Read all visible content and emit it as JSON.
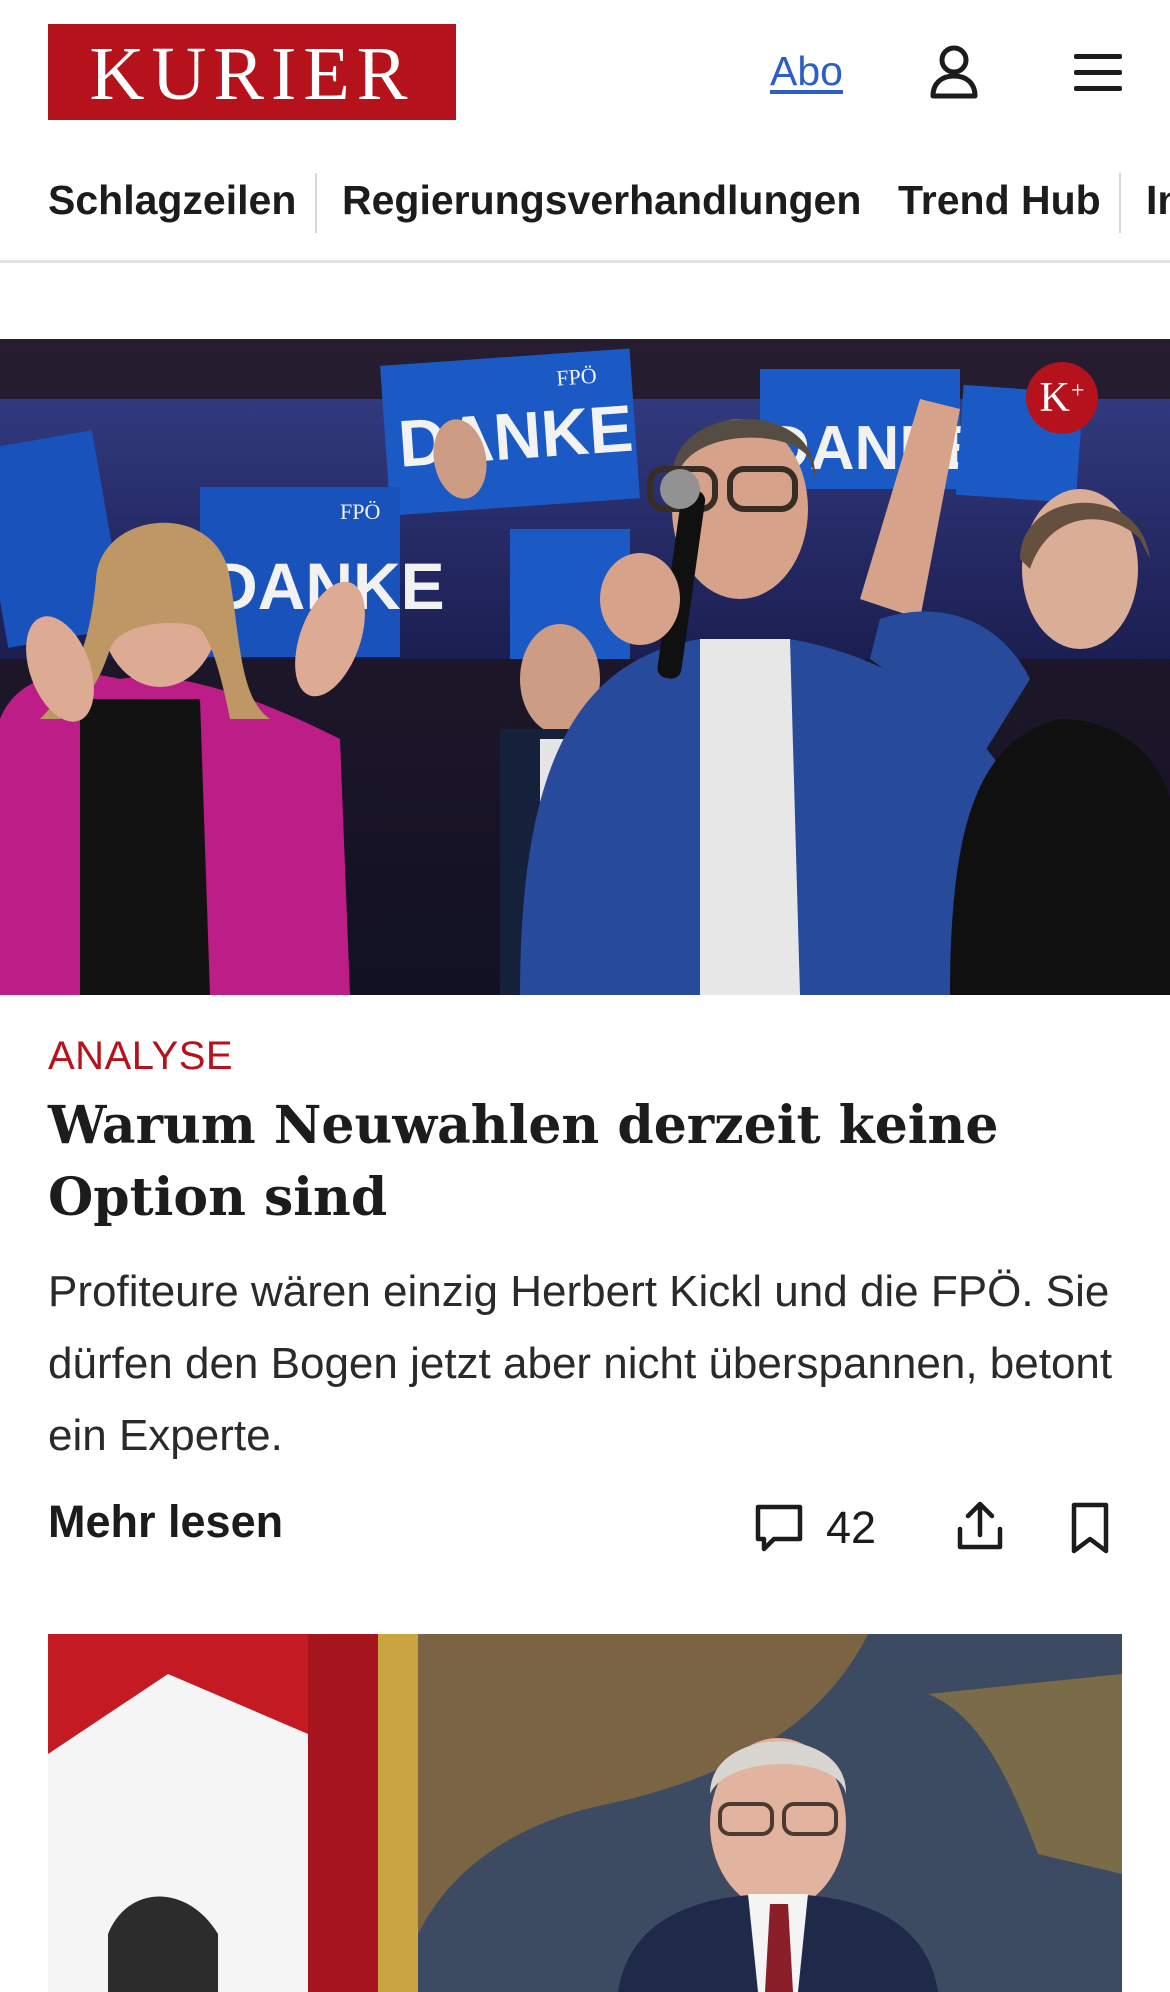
{
  "header": {
    "logo_text": "KURIER",
    "abo_label": "Abo",
    "user_icon": "user-icon",
    "menu_icon": "hamburger-menu-icon"
  },
  "nav": {
    "items": [
      {
        "label": "Schlagzeilen"
      },
      {
        "label": "Regierungsverhandlungen"
      },
      {
        "label": "Trend Hub"
      },
      {
        "label": "In"
      }
    ]
  },
  "hero": {
    "image_alt": "",
    "sign_text": "DANKE",
    "party_text": "FPÖ",
    "badge_text": "K",
    "badge_sup": "+"
  },
  "article": {
    "kicker": "ANALYSE",
    "headline": "Warum Neuwahlen derzeit keine Option sind",
    "teaser": "Profiteure wären einzig Herbert Kickl und die FPÖ. Sie dürfen den Bogen jetzt aber nicht überspannen, betont ein Experte.",
    "more_label": "Mehr lesen",
    "comment_count": "42",
    "comment_icon": "comment-icon",
    "share_icon": "share-icon",
    "bookmark_icon": "bookmark-icon"
  },
  "colors": {
    "brand_red": "#b5121b",
    "link_blue": "#2b5fc6",
    "text": "#1c1c1c"
  }
}
